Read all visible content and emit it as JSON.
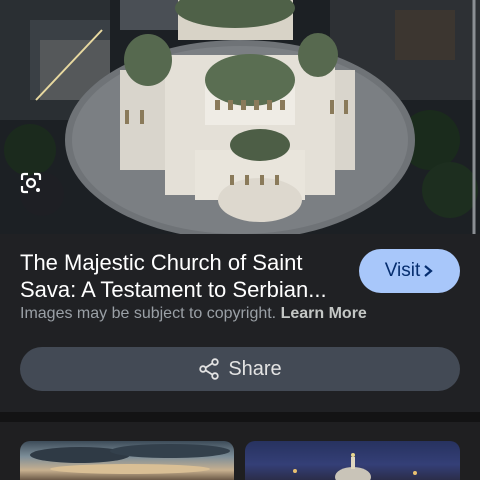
{
  "hero": {
    "image": "aerial-night-view-church-of-saint-sava",
    "lens_icon": "google-lens-icon"
  },
  "result": {
    "title": "The Majestic Church of Saint Sava: A Testament to Serbian...",
    "visit_label": "Visit",
    "visit_icon": "chevron-right-icon",
    "copyright_text": "Images may be subject to copyright.",
    "learn_more_label": "Learn More",
    "share_label": "Share",
    "share_icon": "share-icon"
  },
  "related": {
    "thumbnails": [
      "cloudy-sky-sunset-thumbnail",
      "night-church-dome-thumbnail"
    ]
  },
  "colors": {
    "panel_bg": "#202124",
    "visit_bg": "#a8c7fa",
    "visit_text": "#062e6f",
    "share_bg": "#434a55"
  }
}
